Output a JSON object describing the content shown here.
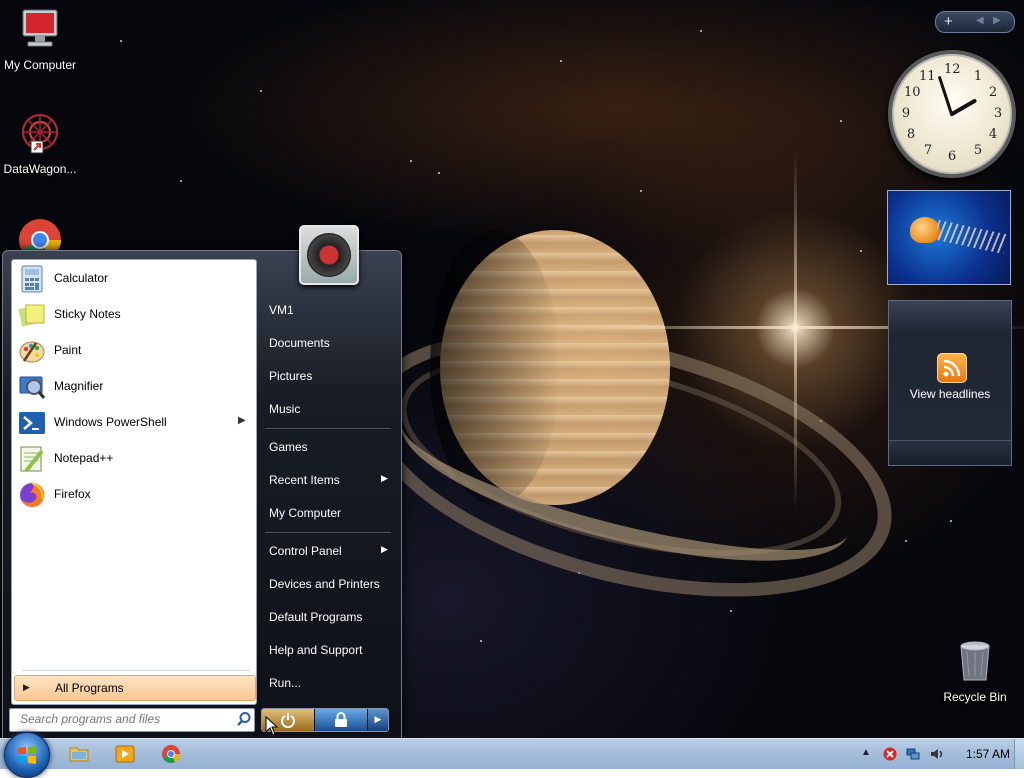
{
  "desktop": {
    "icons": [
      {
        "label": "My Computer"
      },
      {
        "label": "DataWagon..."
      },
      {
        "label": "Recycle Bin"
      }
    ]
  },
  "gadgets": {
    "clock": {
      "numbers": [
        "12",
        "1",
        "2",
        "3",
        "4",
        "5",
        "6",
        "7",
        "8",
        "9",
        "10",
        "11"
      ]
    },
    "feed_headlines": {
      "label": "View headlines"
    }
  },
  "start_menu": {
    "programs": [
      {
        "label": "Calculator",
        "icon": "calculator-icon",
        "color": "#7aa9d6"
      },
      {
        "label": "Sticky Notes",
        "icon": "sticky-notes-icon",
        "color": "#c8e07a"
      },
      {
        "label": "Paint",
        "icon": "paint-icon",
        "color": "#e8b75a"
      },
      {
        "label": "Magnifier",
        "icon": "magnifier-icon",
        "color": "#5d8fd6"
      },
      {
        "label": "Windows PowerShell",
        "icon": "powershell-icon",
        "color": "#1f5fb0",
        "has_submenu": true
      },
      {
        "label": "Notepad++",
        "icon": "notepad-plus-plus-icon",
        "color": "#8cc44b"
      },
      {
        "label": "Firefox",
        "icon": "firefox-icon",
        "color": "#ff7a1a"
      }
    ],
    "all_programs": "All Programs",
    "search": {
      "placeholder": "Search programs and files"
    },
    "right_items": [
      {
        "label": "VM1"
      },
      {
        "label": "Documents"
      },
      {
        "label": "Pictures"
      },
      {
        "label": "Music"
      },
      {
        "label": "Games"
      },
      {
        "label": "Recent Items",
        "has_submenu": true
      },
      {
        "label": "My Computer"
      },
      {
        "label": "Control Panel",
        "has_submenu": true
      },
      {
        "label": "Devices and Printers"
      },
      {
        "label": "Default Programs"
      },
      {
        "label": "Help and Support"
      },
      {
        "label": "Run..."
      }
    ]
  },
  "taskbar": {
    "pinned": [
      "file-explorer-icon",
      "media-player-icon",
      "chrome-icon"
    ],
    "tray": {
      "time": "1:57 AM"
    }
  }
}
